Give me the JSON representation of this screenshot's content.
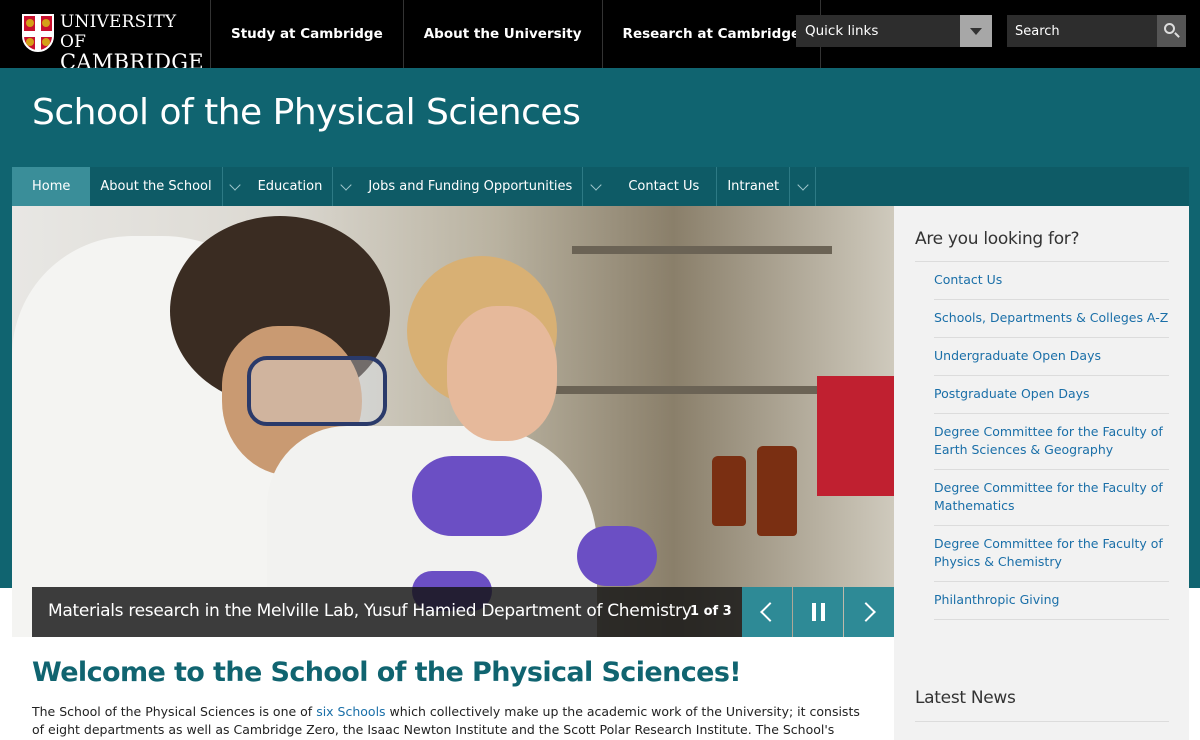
{
  "brand": {
    "line1": "UNIVERSITY OF",
    "line2": "CAMBRIDGE"
  },
  "topnav": [
    "Study at Cambridge",
    "About the University",
    "Research at Cambridge"
  ],
  "quicklinks": {
    "label": "Quick links"
  },
  "search": {
    "placeholder": "Search"
  },
  "site_title": "School of the Physical Sciences",
  "mainnav": [
    {
      "label": "Home",
      "active": true
    },
    {
      "label": "About the School"
    },
    {
      "label": "Education"
    },
    {
      "label": "Jobs and Funding Opportunities"
    },
    {
      "label": "Contact Us"
    },
    {
      "label": "Intranet"
    }
  ],
  "carousel": {
    "caption": "Materials research in the Melville Lab, Yusuf Hamied Department of Chemistry",
    "counter": "1 of 3"
  },
  "sidebar": {
    "heading": "Are you looking for?",
    "links": [
      "Contact Us",
      "Schools, Departments & Colleges A-Z",
      "Undergraduate Open Days",
      "Postgraduate Open Days",
      "Degree Committee for the Faculty of Earth Sciences & Geography",
      "Degree Committee for the Faculty of Mathematics",
      "Degree Committee for the Faculty of Physics & Chemistry",
      "Philanthropic Giving"
    ],
    "news_heading": "Latest News"
  },
  "content": {
    "heading": "Welcome to the School of the Physical Sciences!",
    "intro_pre": "The School of the Physical Sciences is one of ",
    "intro_link": "six Schools",
    "intro_post": " which collectively make up the academic work of the University; it consists of eight departments as well as Cambridge Zero, the Isaac Newton Institute and the Scott Polar Research Institute.  The School's"
  },
  "colors": {
    "teal": "#106470",
    "teal_dark": "#0e5b66",
    "accent": "#2e8a96",
    "link": "#1a6fa8"
  }
}
